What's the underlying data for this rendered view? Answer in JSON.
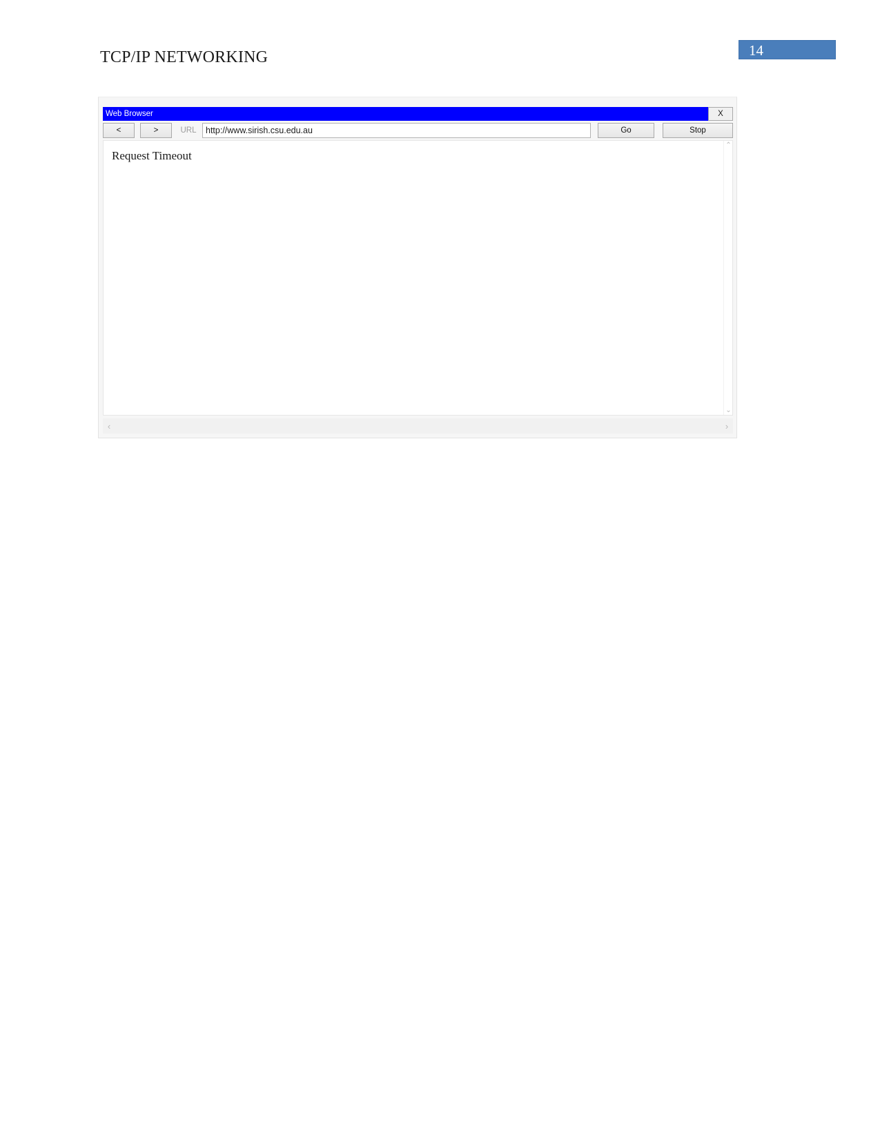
{
  "document": {
    "title": "TCP/IP NETWORKING",
    "page_number": "14",
    "page_number_bg": "#4a7ebb",
    "page_number_color": "#ffffff"
  },
  "browser_window": {
    "title_bar": {
      "label": "Web Browser",
      "background": "#0000ff",
      "text_color": "#ffffff",
      "close_label": "X"
    },
    "toolbar": {
      "back_label": "<",
      "forward_label": ">",
      "url_label": "URL",
      "url_value": "http://www.sirish.csu.edu.au",
      "url_placeholder": "http://",
      "go_label": "Go",
      "stop_label": "Stop"
    },
    "content": {
      "message": "Request Timeout"
    },
    "scrollbars": {
      "up_arrow": "⌃",
      "down_arrow": "⌄",
      "left_arrow": "‹",
      "right_arrow": "›"
    }
  }
}
